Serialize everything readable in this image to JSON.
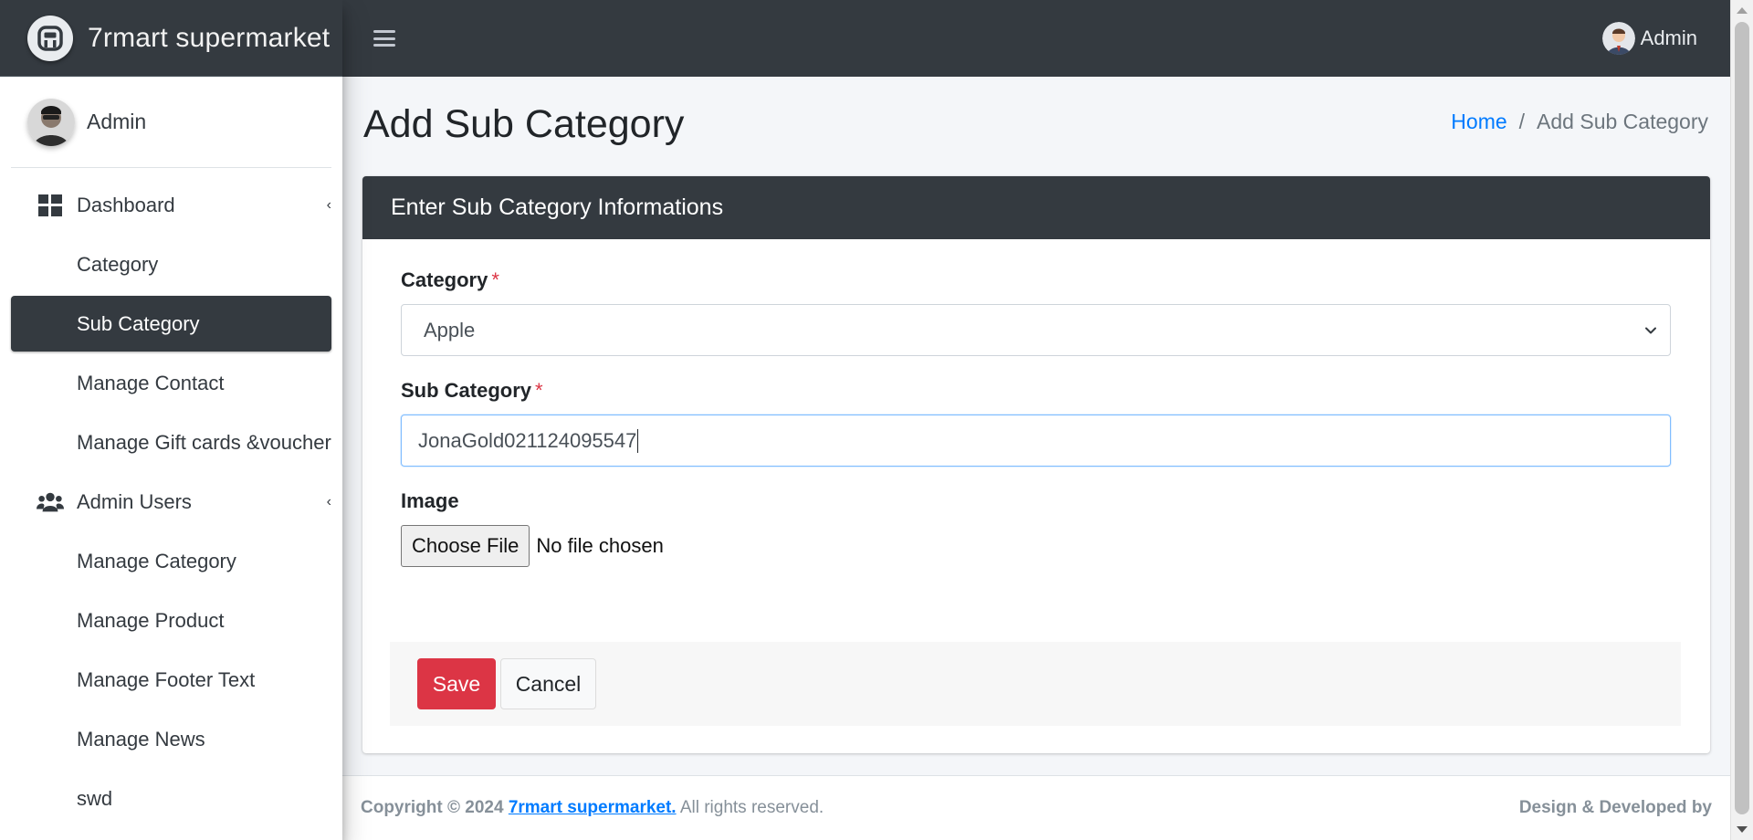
{
  "brand": {
    "name": "7rmart supermarket"
  },
  "topbar": {
    "user_name": "Admin"
  },
  "sidebar": {
    "user_name": "Admin",
    "items": [
      {
        "label": "Dashboard",
        "icon": "dashboard-icon",
        "has_caret": true
      },
      {
        "label": "Category"
      },
      {
        "label": "Sub Category",
        "active": true
      },
      {
        "label": "Manage Contact"
      },
      {
        "label": "Manage Gift cards &voucher"
      },
      {
        "label": "Admin Users",
        "icon": "users-icon",
        "has_caret": true
      },
      {
        "label": "Manage Category"
      },
      {
        "label": "Manage Product"
      },
      {
        "label": "Manage Footer Text"
      },
      {
        "label": "Manage News"
      },
      {
        "label": "swd"
      }
    ]
  },
  "page": {
    "title": "Add Sub Category",
    "breadcrumb": {
      "home": "Home",
      "separator": "/",
      "current": "Add Sub Category"
    }
  },
  "form": {
    "header": "Enter Sub Category Informations",
    "category_label": "Category",
    "required_mark": "*",
    "category_selected": "Apple",
    "subcategory_label": "Sub Category",
    "subcategory_value": "JonaGold021124095547",
    "image_label": "Image",
    "file_button": "Choose File",
    "file_status": "No file chosen",
    "save_label": "Save",
    "cancel_label": "Cancel"
  },
  "footer": {
    "copyright_prefix": "Copyright © 2024",
    "brand_link": "7rmart supermarket.",
    "rights": "All rights reserved.",
    "right_text": "Design & Developed by"
  },
  "colors": {
    "dark": "#343a40",
    "primary_link": "#007bff",
    "danger": "#dc3545",
    "content_bg": "#f4f6f9"
  }
}
